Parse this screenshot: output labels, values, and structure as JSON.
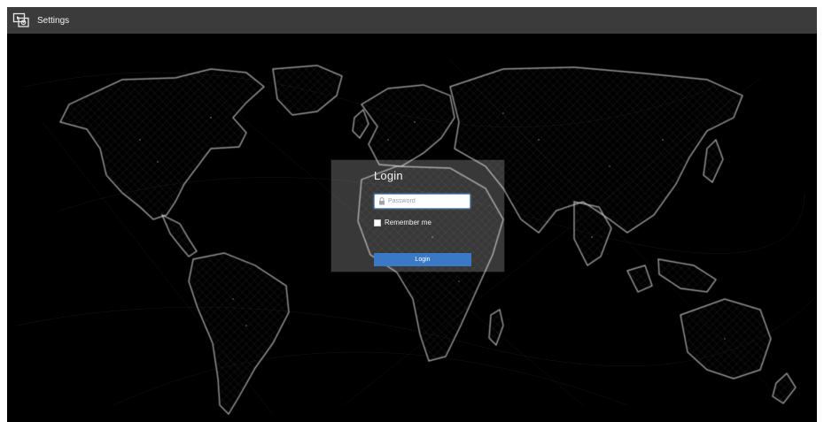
{
  "topbar": {
    "icon": "app-settings-icon",
    "title": "Settings"
  },
  "login": {
    "title": "Login",
    "password": {
      "icon": "lock-icon",
      "placeholder": "Password",
      "value": ""
    },
    "remember_label": "Remember me",
    "remember_checked": false,
    "button_label": "Login"
  },
  "colors": {
    "topbar_bg": "#3b3b3b",
    "background": "#000000",
    "button": "#3a79c5",
    "input_focus": "#6f9bd6"
  }
}
